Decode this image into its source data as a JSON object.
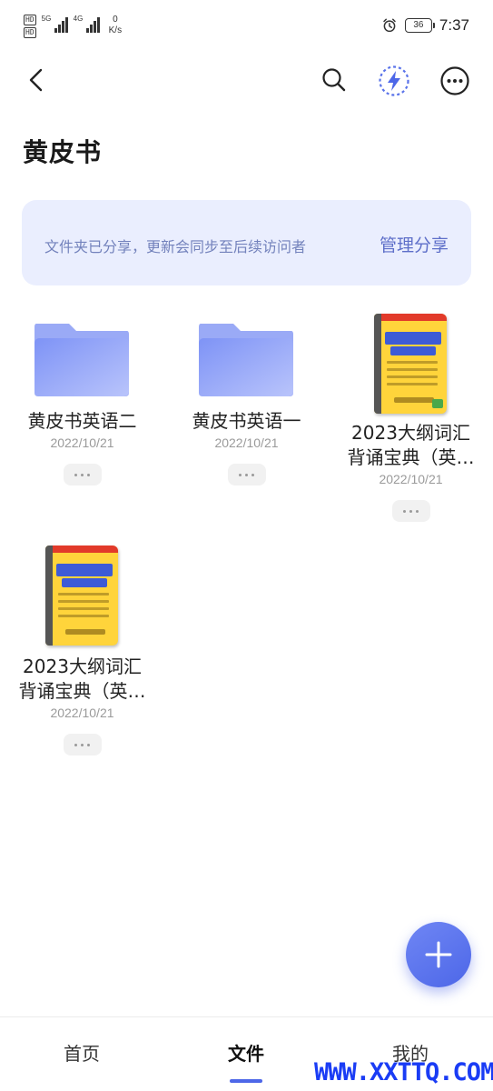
{
  "status_bar": {
    "sim1": "HD",
    "sim2": "HD",
    "net1": "5G",
    "net2": "4G",
    "speed_value": "0",
    "speed_unit": "K/s",
    "battery": "36",
    "time": "7:37"
  },
  "header": {
    "icons": [
      "back-icon",
      "search-icon",
      "flash-icon",
      "more-icon"
    ]
  },
  "page": {
    "title": "黄皮书"
  },
  "share_banner": {
    "note": "文件夹已分享，更新会同步至后续访问者",
    "action": "管理分享"
  },
  "items": [
    {
      "type": "folder",
      "name": "黄皮书英语二",
      "date": "2022/10/21"
    },
    {
      "type": "folder",
      "name": "黄皮书英语一",
      "date": "2022/10/21"
    },
    {
      "type": "book",
      "name": "2023大纲词汇背诵宝典（英…",
      "date": "2022/10/21"
    },
    {
      "type": "book",
      "name": "2023大纲词汇背诵宝典（英…",
      "date": "2022/10/21"
    }
  ],
  "bottom_nav": {
    "tabs": [
      {
        "label": "首页"
      },
      {
        "label": "文件"
      },
      {
        "label": "我的"
      }
    ],
    "active": "文件"
  },
  "watermark": "WWW.XXTTQ.COM",
  "colors": {
    "accent": "#4d67e8",
    "banner_bg": "#eaeefe",
    "folder": "#8c9cf3"
  }
}
